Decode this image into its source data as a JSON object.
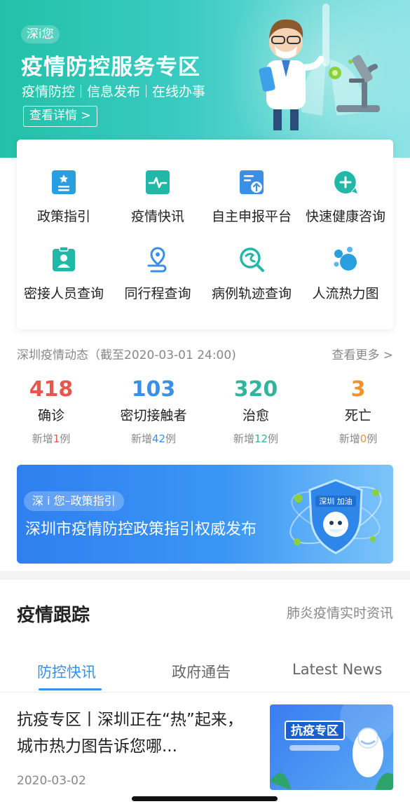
{
  "hero": {
    "tag": "深i您",
    "title": "疫情防控服务专区",
    "subtitle_items": [
      "疫情防控",
      "信息发布",
      "在线办事"
    ],
    "details_button": "查看详情 >"
  },
  "services": [
    {
      "label": "政策指引",
      "icon": "policy-doc-icon",
      "color": "#2a9fe0"
    },
    {
      "label": "疫情快讯",
      "icon": "pulse-icon",
      "color": "#22b8a8"
    },
    {
      "label": "自主申报平台",
      "icon": "upload-form-icon",
      "color": "#3a8fe6"
    },
    {
      "label": "快速健康咨询",
      "icon": "plus-chat-icon",
      "color": "#22b8a8"
    },
    {
      "label": "密接人员查询",
      "icon": "person-badge-icon",
      "color": "#22b8a8"
    },
    {
      "label": "同行程查询",
      "icon": "location-route-icon",
      "color": "#3a8fe6"
    },
    {
      "label": "病例轨迹查询",
      "icon": "search-track-icon",
      "color": "#22b8a8"
    },
    {
      "label": "人流热力图",
      "icon": "bubbles-icon",
      "color": "#2a9fe0"
    }
  ],
  "stats": {
    "header": "深圳疫情动态（截至2020-03-01 24:00)",
    "more": "查看更多 >",
    "inc_prefix": "新增",
    "inc_suffix": "例",
    "items": [
      {
        "value": "418",
        "label": "确诊",
        "increase": "1",
        "color": "#e8574e"
      },
      {
        "value": "103",
        "label": "密切接触者",
        "increase": "42",
        "color": "#3a8fe6"
      },
      {
        "value": "320",
        "label": "治愈",
        "increase": "12",
        "color": "#2fb59c"
      },
      {
        "value": "3",
        "label": "死亡",
        "increase": "0",
        "color": "#f0932b"
      }
    ]
  },
  "banner": {
    "tag": "深 i 您–政策指引",
    "title": "深圳市疫情防控政策指引权威发布",
    "shield_text": "深圳 加油"
  },
  "tracking": {
    "title": "疫情跟踪",
    "subtitle": "肺炎疫情实时资讯",
    "tabs": [
      "防控快讯",
      "政府通告",
      "Latest News"
    ]
  },
  "article": {
    "title": "抗疫专区丨深圳正在“热”起来，城市热力图告诉您哪...",
    "date": "2020-03-02",
    "thumb_text": "抗疫专区"
  }
}
